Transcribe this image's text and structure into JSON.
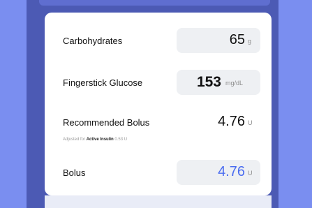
{
  "colors": {
    "background": "#7a8ef0",
    "frame": "#4c5ab4",
    "card": "#ffffff",
    "field": "#eef0f3",
    "accent_blue": "#4a6cf0"
  },
  "rows": [
    {
      "label": "Carbohydrates",
      "value": "65",
      "unit": "g"
    },
    {
      "label": "Fingerstick Glucose",
      "value": "153",
      "unit": "mg/dL"
    },
    {
      "label": "Recommended Bolus",
      "value": "4.76",
      "unit": "U",
      "note_prefix": "Adjusted for",
      "note_bold": "Active Insulin",
      "note_value": "0.53 U"
    },
    {
      "label": "Bolus",
      "value": "4.76",
      "unit": "U"
    }
  ]
}
